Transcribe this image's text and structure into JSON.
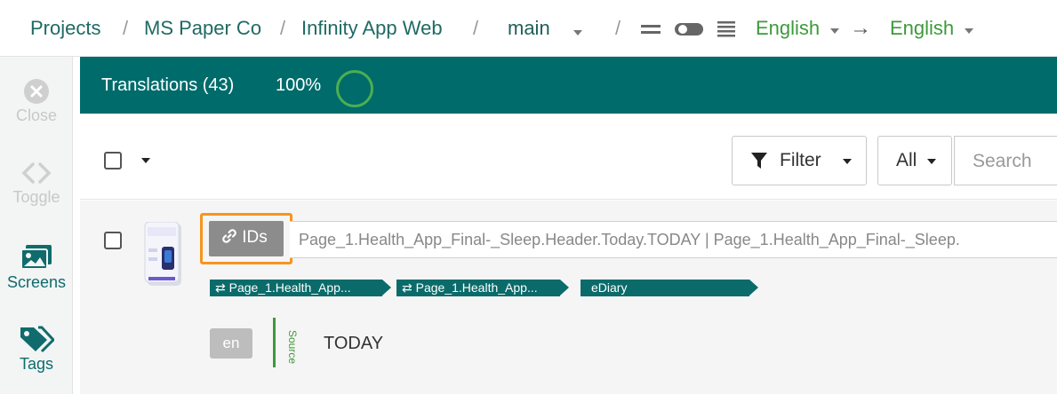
{
  "breadcrumb": {
    "projects": "Projects",
    "organization": "MS Paper Co",
    "project": "Infinity App Web",
    "branch": "main",
    "separator": "/",
    "source_language": "English",
    "target_language": "English",
    "arrow": "→"
  },
  "sidebar": {
    "items": [
      {
        "label": "Close",
        "icon": "close-circle-icon",
        "enabled": false
      },
      {
        "label": "Toggle",
        "icon": "code-brackets-icon",
        "enabled": false
      },
      {
        "label": "Screens",
        "icon": "images-icon",
        "enabled": true
      },
      {
        "label": "Tags",
        "icon": "tags-icon",
        "enabled": true
      }
    ]
  },
  "header": {
    "title": "Translations (43)",
    "progress_label": "100%",
    "progress": 1.0
  },
  "toolbar": {
    "filter_label": "Filter",
    "scope_value": "All",
    "search_placeholder": "Search"
  },
  "rows": [
    {
      "ids_label": "IDs",
      "key_text": "Page_1.Health_App_Final-_Sleep.Header.Today.TODAY | Page_1.Health_App_Final-_Sleep.",
      "tags": [
        "Page_1.Health_App...",
        "Page_1.Health_App...",
        "eDiary"
      ],
      "language_code": "en",
      "source_label": "Source",
      "source_text": "TODAY"
    }
  ],
  "colors": {
    "brand_teal": "#006b6b",
    "language_green": "#3d9a3a",
    "highlight_orange": "#f7941d",
    "progress_ring": "#4caf50"
  }
}
